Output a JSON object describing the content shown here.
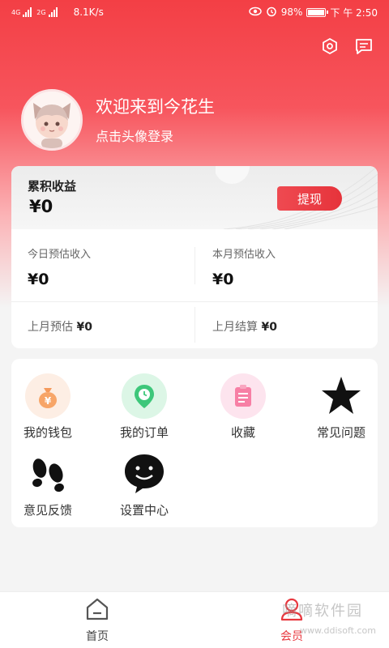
{
  "status_bar": {
    "network": "4G",
    "network2": "2G",
    "speed": "8.1K/s",
    "battery": "98%",
    "battery_level": 0.98,
    "time": "下 午 2:50"
  },
  "header": {
    "welcome": "欢迎来到今花生",
    "login_hint": "点击头像登录"
  },
  "earnings": {
    "title": "累积收益",
    "total": "¥0",
    "withdraw_label": "提现",
    "today_label": "今日预估收入",
    "today_value": "¥0",
    "month_label": "本月预估收入",
    "month_value": "¥0",
    "last_month_est_label": "上月预估",
    "last_month_est_value": "¥0",
    "last_month_settle_label": "上月结算",
    "last_month_settle_value": "¥0"
  },
  "menu": {
    "wallet": "我的钱包",
    "orders": "我的订单",
    "favorites": "收藏",
    "faq": "常见问题",
    "feedback": "意见反馈",
    "settings": "设置中心"
  },
  "bottom_nav": {
    "home": "首页",
    "member": "会员",
    "active": "member"
  },
  "watermark": {
    "text": "嘀嘀软件园",
    "url": "www.ddisoft.com"
  },
  "colors": {
    "accent": "#e8383f",
    "hero_top": "#f33f45"
  }
}
